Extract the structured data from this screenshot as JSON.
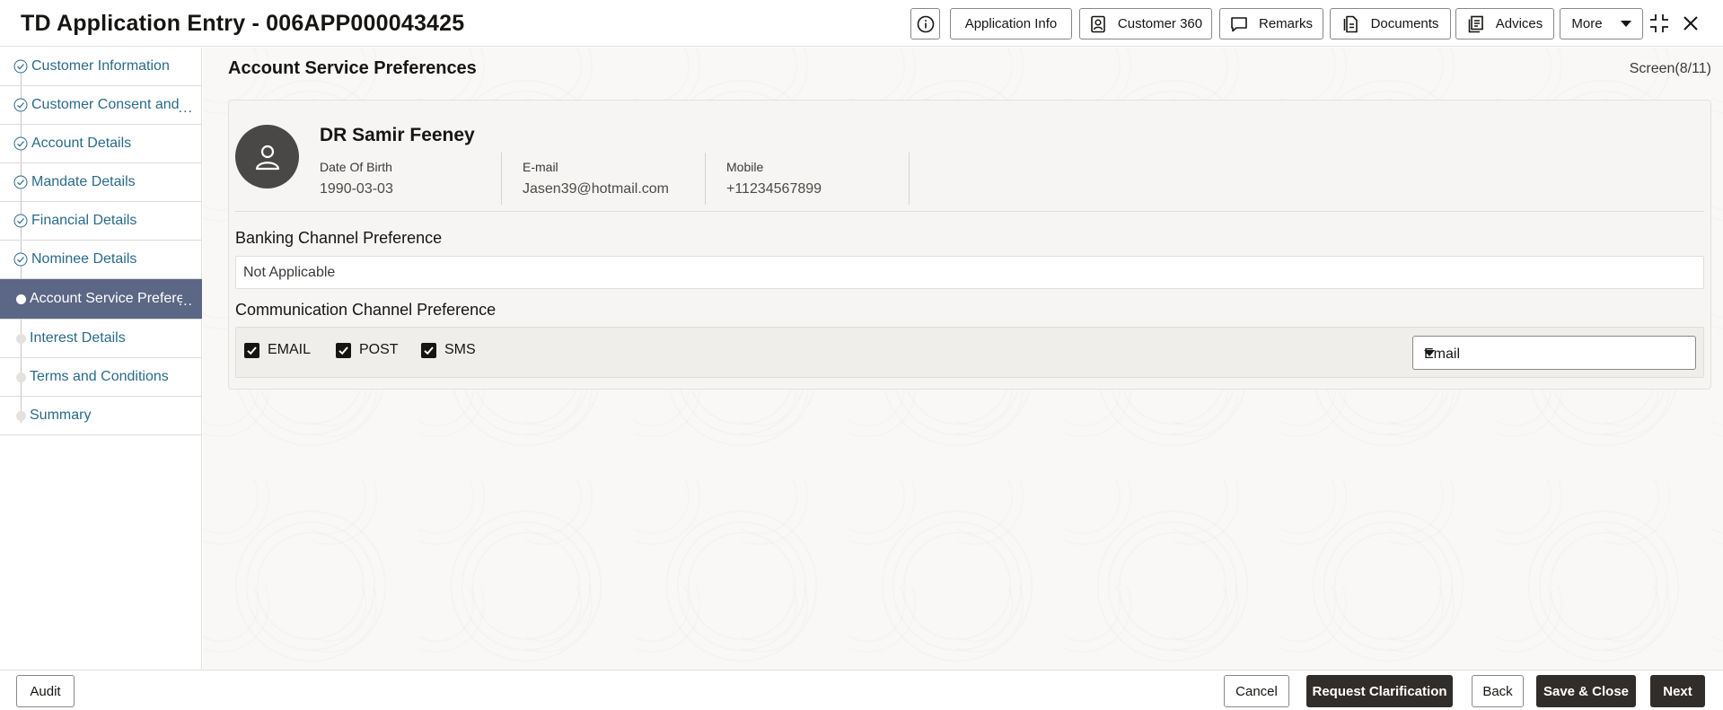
{
  "header": {
    "title": "TD Application Entry - 006APP000043425",
    "buttons": {
      "application_info": "Application Info",
      "customer_360": "Customer 360",
      "remarks": "Remarks",
      "documents": "Documents",
      "advices": "Advices",
      "more": "More"
    }
  },
  "sidebar": {
    "items": [
      {
        "label": "Customer Information",
        "state": "done"
      },
      {
        "label": "Customer Consent and",
        "state": "done",
        "overflow": "..."
      },
      {
        "label": "Account Details",
        "state": "done"
      },
      {
        "label": "Mandate Details",
        "state": "done"
      },
      {
        "label": "Financial Details",
        "state": "done"
      },
      {
        "label": "Nominee Details",
        "state": "done"
      },
      {
        "label": "Account Service Prefere",
        "state": "active",
        "overflow": "..."
      },
      {
        "label": "Interest Details",
        "state": "upcoming"
      },
      {
        "label": "Terms and Conditions",
        "state": "upcoming"
      },
      {
        "label": "Summary",
        "state": "upcoming"
      }
    ]
  },
  "main": {
    "page_title": "Account Service Preferences",
    "screen_count": "Screen(8/11)",
    "customer": {
      "name": "DR Samir Feeney",
      "dob_label": "Date Of Birth",
      "dob": "1990-03-03",
      "email_label": "E-mail",
      "email": "Jasen39@hotmail.com",
      "mobile_label": "Mobile",
      "mobile": "+11234567899"
    },
    "banking_channel": {
      "title": "Banking Channel Preference",
      "value": "Not Applicable"
    },
    "communication_channel": {
      "title": "Communication Channel Preference",
      "options": [
        {
          "label": "EMAIL",
          "checked": true
        },
        {
          "label": "POST",
          "checked": true
        },
        {
          "label": "SMS",
          "checked": true
        }
      ],
      "preferred": "Email"
    }
  },
  "footer": {
    "audit": "Audit",
    "cancel": "Cancel",
    "request_clarification": "Request Clarification",
    "back": "Back",
    "save_close": "Save & Close",
    "next": "Next"
  },
  "colors": {
    "active_step_bg": "#5b6785",
    "link_text": "#2a6a89",
    "primary_button": "#312d2a"
  }
}
